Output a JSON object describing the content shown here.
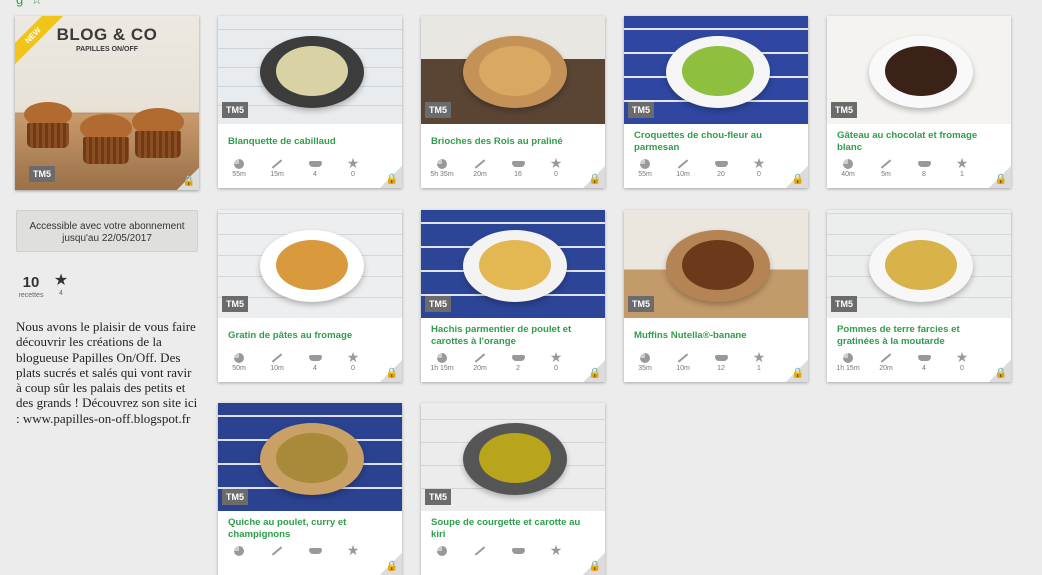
{
  "header": {
    "fragment": "g ☆"
  },
  "book": {
    "title": "BLOG & CO",
    "subtitle": "PAPILLES ON/OFF",
    "badge": "NEW",
    "tm_tag": "TM5"
  },
  "sidebar": {
    "access_text": "Accessible avec votre abonnement jusqu'au 22/05/2017",
    "recipe_count": "10",
    "recipe_label": "recettes",
    "star_count": "4",
    "description": "Nous avons le plaisir de vous faire découvrir les créations de la blogueuse Papilles On/Off. Des plats sucrés et salés qui vont ravir à coup sûr les palais des petits et des grands ! Découvrez son site ici : www.papilles-on-off.blogspot.fr"
  },
  "colors": {
    "accent": "#2e9e4a",
    "tag": "#6b6b6b"
  },
  "icons": {
    "time": "clock-icon",
    "prep": "knife-icon",
    "portions": "pot-icon",
    "rating": "star-icon",
    "lock": "lock-icon"
  },
  "cards": [
    {
      "title": "Blanquette de cabillaud",
      "tag": "TM5",
      "time": "55m",
      "prep": "15m",
      "portions": "4",
      "rating": "0"
    },
    {
      "title": "Brioches des Rois au praliné",
      "tag": "TM5",
      "time": "5h 35m",
      "prep": "20m",
      "portions": "16",
      "rating": "0"
    },
    {
      "title": "Croquettes de chou-fleur au parmesan",
      "tag": "TM5",
      "time": "55m",
      "prep": "10m",
      "portions": "20",
      "rating": "0"
    },
    {
      "title": "Gâteau au chocolat et fromage blanc",
      "tag": "TM5",
      "time": "40m",
      "prep": "5m",
      "portions": "8",
      "rating": "1"
    },
    {
      "title": "Gratin de pâtes au fromage",
      "tag": "TM5",
      "time": "50m",
      "prep": "10m",
      "portions": "4",
      "rating": "0"
    },
    {
      "title": "Hachis parmentier de poulet et carottes à l'orange",
      "tag": "TM5",
      "time": "1h 15m",
      "prep": "20m",
      "portions": "2",
      "rating": "0"
    },
    {
      "title": "Muffins Nutella®-banane",
      "tag": "TM5",
      "time": "35m",
      "prep": "10m",
      "portions": "12",
      "rating": "1"
    },
    {
      "title": "Pommes de terre farcies et gratinées à la moutarde",
      "tag": "TM5",
      "time": "1h 15m",
      "prep": "20m",
      "portions": "4",
      "rating": "0"
    },
    {
      "title": "Quiche au poulet, curry et champignons",
      "tag": "TM5",
      "time": "",
      "prep": "",
      "portions": "",
      "rating": ""
    },
    {
      "title": "Soupe de courgette et carotte au kiri",
      "tag": "TM5",
      "time": "",
      "prep": "",
      "portions": "",
      "rating": ""
    }
  ]
}
